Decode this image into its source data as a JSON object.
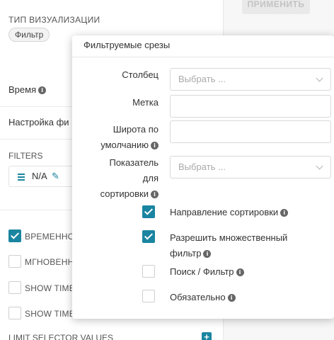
{
  "toolbar": {
    "apply_label": "ПРИМЕНИТЬ"
  },
  "panel": {
    "viz_type_label": "ТИП ВИЗУАЛИЗАЦИИ",
    "viz_type_value": "Фильтр",
    "time_label": "Время",
    "filter_settings_label": "Настройка фи",
    "filters_label": "FILTERS",
    "filter_item_label": "N/A",
    "checkboxes": [
      {
        "label": "ВРЕМЕННО",
        "checked": true
      },
      {
        "label": "МГНОВЕНН",
        "checked": false
      },
      {
        "label": "SHOW TIME",
        "checked": false
      },
      {
        "label": "SHOW TIME",
        "checked": false
      }
    ],
    "limit_label": "LIMIT SELECTOR VALUES"
  },
  "dialog": {
    "title": "Фильтруемые срезы",
    "fields": {
      "column_label": "Столбец",
      "column_placeholder": "Выбрать ...",
      "label_label": "Метка",
      "label_value": "",
      "width_label_line1": "Широта по",
      "width_label_line2": "умолчанию",
      "width_value": "",
      "metric_label_line1": "Показатель",
      "metric_label_line2": "для",
      "metric_label_line3": "сортировки",
      "metric_placeholder": "Выбрать ..."
    },
    "options": [
      {
        "line1": "Направление сортировки",
        "line2": "",
        "checked": true
      },
      {
        "line1": "Разрешить множественный",
        "line2": "фильтр",
        "checked": true
      },
      {
        "line1": "Поиск / Фильтр",
        "line2": "",
        "checked": false
      },
      {
        "line1": "Обязательно",
        "line2": "",
        "checked": false
      }
    ]
  },
  "colors": {
    "accent": "#1a85a0",
    "border": "#d9d9d9"
  },
  "icons": [
    "info-icon",
    "edit-icon",
    "menu-icon",
    "chevron-down-icon",
    "plus-icon"
  ]
}
